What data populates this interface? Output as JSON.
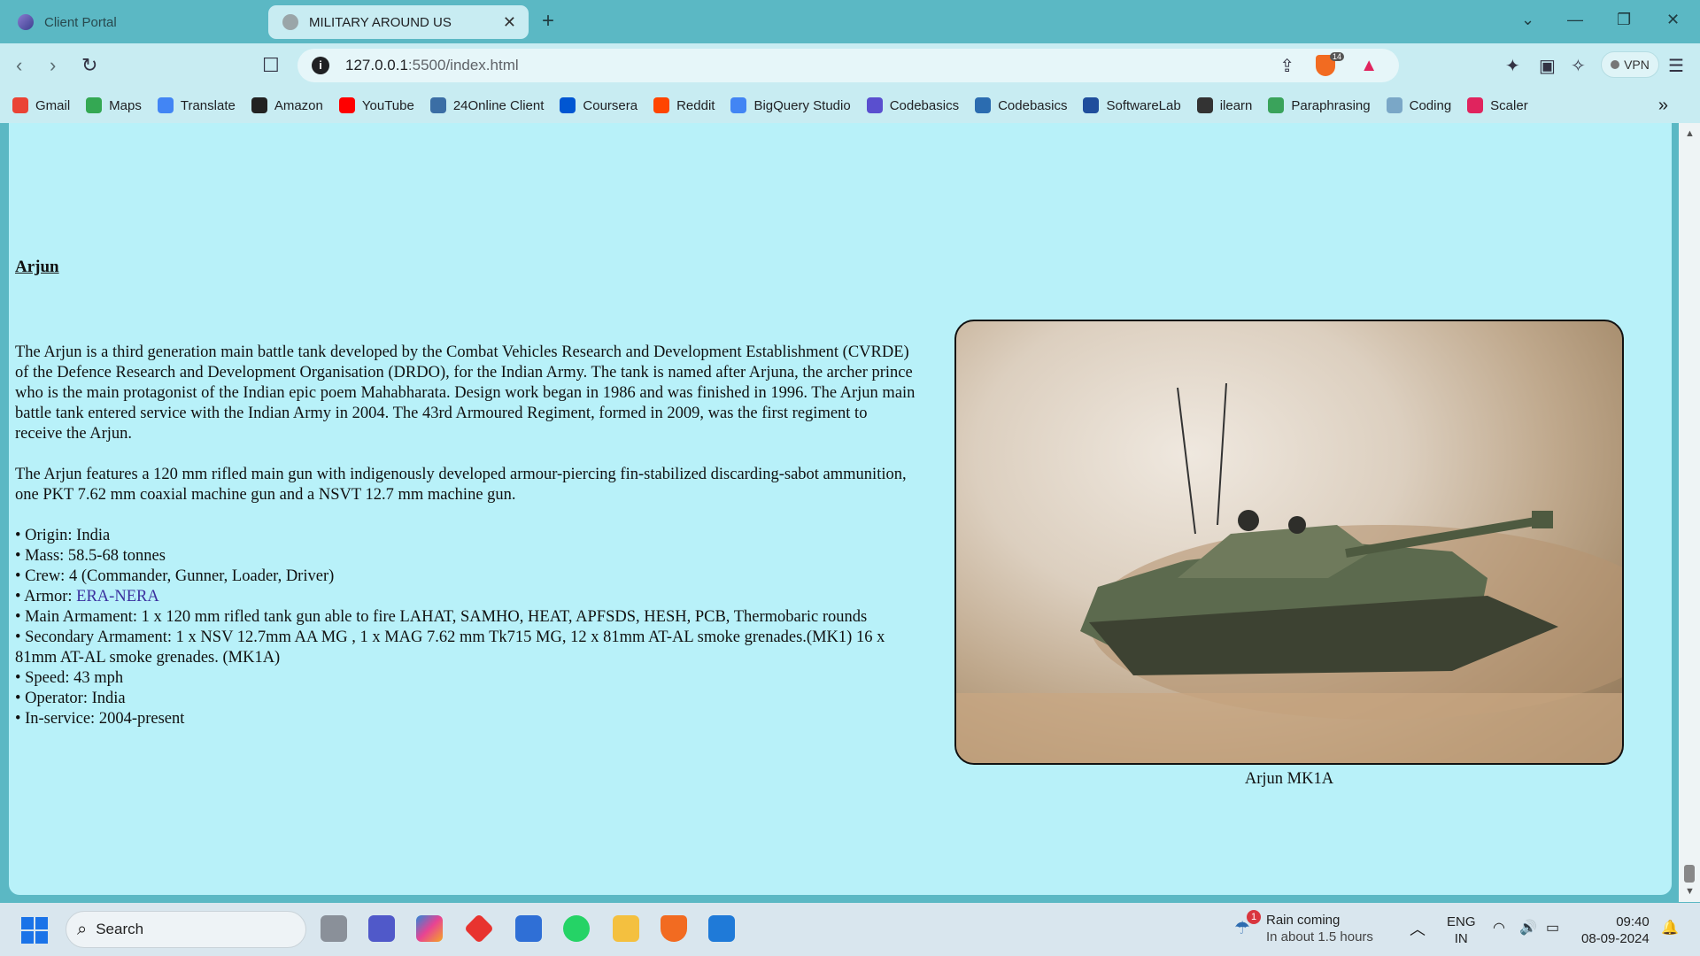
{
  "browser": {
    "tabs": [
      {
        "label": "Client Portal",
        "active": false
      },
      {
        "label": "MILITARY AROUND US",
        "active": true
      }
    ],
    "url_host": "127.0.0.1",
    "url_rest": ":5500/index.html",
    "vpn_label": "VPN",
    "shield_count": "14",
    "bookmarks": [
      {
        "label": "Gmail",
        "icon": "gmail-icon",
        "color": "#ea4335"
      },
      {
        "label": "Maps",
        "icon": "maps-icon",
        "color": "#34a853"
      },
      {
        "label": "Translate",
        "icon": "translate-icon",
        "color": "#4285f4"
      },
      {
        "label": "Amazon",
        "icon": "amazon-icon",
        "color": "#222222"
      },
      {
        "label": "YouTube",
        "icon": "youtube-icon",
        "color": "#ff0000"
      },
      {
        "label": "24Online Client",
        "icon": "24online-icon",
        "color": "#3b6ea5"
      },
      {
        "label": "Coursera",
        "icon": "coursera-icon",
        "color": "#0056d2"
      },
      {
        "label": "Reddit",
        "icon": "reddit-icon",
        "color": "#ff4500"
      },
      {
        "label": "BigQuery Studio",
        "icon": "bigquery-icon",
        "color": "#4285f4"
      },
      {
        "label": "Codebasics",
        "icon": "rocket-icon",
        "color": "#5a4fcf"
      },
      {
        "label": "Codebasics",
        "icon": "codebasics-icon",
        "color": "#2b6cb0"
      },
      {
        "label": "SoftwareLab",
        "icon": "softwarelab-icon",
        "color": "#1f4e9c"
      },
      {
        "label": "ilearn",
        "icon": "ilearn-icon",
        "color": "#333333"
      },
      {
        "label": "Paraphrasing",
        "icon": "paraphrasing-icon",
        "color": "#3aa35b"
      },
      {
        "label": "Coding",
        "icon": "coding-icon",
        "color": "#7aa7c7"
      },
      {
        "label": "Scaler",
        "icon": "scaler-icon",
        "color": "#e0245e"
      }
    ]
  },
  "article": {
    "title": "Arjun",
    "para1": "The Arjun is a third generation main battle tank developed by the Combat Vehicles Research and Development Establishment (CVRDE) of the Defence Research and Development Organisation (DRDO), for the Indian Army. The tank is named after Arjuna, the archer prince who is the main protagonist of the Indian epic poem Mahabharata. Design work began in 1986 and was finished in 1996. The Arjun main battle tank entered service with the Indian Army in 2004. The 43rd Armoured Regiment, formed in 2009, was the first regiment to receive the Arjun.",
    "para2": "The Arjun features a 120 mm rifled main gun with indigenously developed armour-piercing fin-stabilized discarding-sabot ammunition, one PKT 7.62 mm coaxial machine gun and a NSVT 12.7 mm machine gun.",
    "specs": {
      "origin": "• Origin: India",
      "mass": "• Mass: 58.5-68 tonnes",
      "crew": "• Crew: 4 (Commander, Gunner, Loader, Driver)",
      "armor_prefix": "• Armor: ",
      "armor_link": "ERA-NERA",
      "main_armament": "• Main Armament: 1 x 120 mm rifled tank gun able to fire LAHAT, SAMHO, HEAT, APFSDS, HESH, PCB, Thermobaric rounds",
      "secondary_armament": "• Secondary Armament: 1 x NSV 12.7mm AA MG , 1 x MAG 7.62 mm Tk715 MG, 12 x 81mm AT-AL smoke grenades.(MK1) 16 x 81mm AT-AL smoke grenades. (MK1A)",
      "speed": "• Speed: 43 mph",
      "operator": "• Operator: India",
      "in_service": "• In-service: 2004-present"
    },
    "image_caption": "Arjun MK1A"
  },
  "taskbar": {
    "search_placeholder": "Search",
    "weather_title": "Rain coming",
    "weather_sub": "In about 1.5 hours",
    "weather_badge": "1",
    "lang_top": "ENG",
    "lang_bottom": "IN",
    "time": "09:40",
    "date": "08-09-2024"
  }
}
